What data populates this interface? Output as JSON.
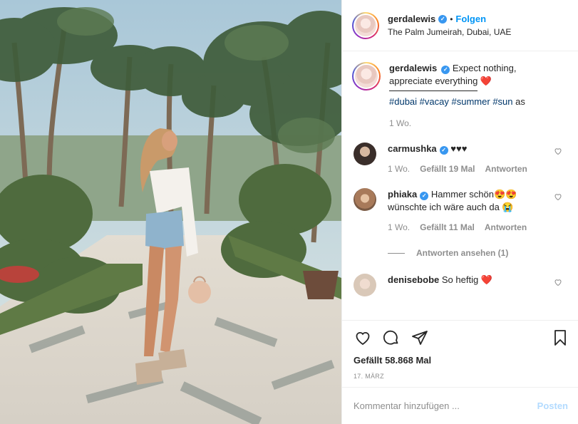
{
  "post": {
    "image_alt": "",
    "header": {
      "username": "gerdalewis",
      "verified": true,
      "separator": "•",
      "follow_label": "Folgen",
      "location": "The Palm Jumeirah, Dubai, UAE"
    },
    "caption": {
      "username": "gerdalewis",
      "text": "Expect nothing, appreciate everything ❤️",
      "hashtags": [
        "#dubai",
        "#vacay",
        "#summer",
        "#sun"
      ],
      "trailing": "as",
      "time": "1 Wo."
    },
    "comments": [
      {
        "username": "carmushka",
        "verified": true,
        "text": "♥♥♥",
        "time": "1 Wo.",
        "likes": "Gefällt 19 Mal",
        "reply_label": "Antworten",
        "avatar_color": "#3a2e2a"
      },
      {
        "username": "phiaka",
        "verified": true,
        "text": "Hammer schön😍😍 wünschte ich wäre auch da 😭",
        "time": "1 Wo.",
        "likes": "Gefällt 11 Mal",
        "reply_label": "Antworten",
        "view_replies": "Antworten ansehen (1)",
        "avatar_color": "#a87a5a"
      },
      {
        "username": "denisebobe",
        "verified": false,
        "text": "So heftig ❤️",
        "avatar_color": "#d9c8b8"
      }
    ],
    "likes": "Gefällt 58.868 Mal",
    "date": "17. MÄRZ",
    "comment_placeholder": "Kommentar hinzufügen ...",
    "post_button": "Posten"
  },
  "colors": {
    "link_blue": "#0095f6",
    "hashtag_blue": "#00376b",
    "muted": "#8e8e8e",
    "heart_red": "#ed4956",
    "post_disabled": "#b3dbff"
  },
  "icons": [
    "heart-icon",
    "comment-icon",
    "share-icon",
    "bookmark-icon",
    "verified-icon"
  ]
}
